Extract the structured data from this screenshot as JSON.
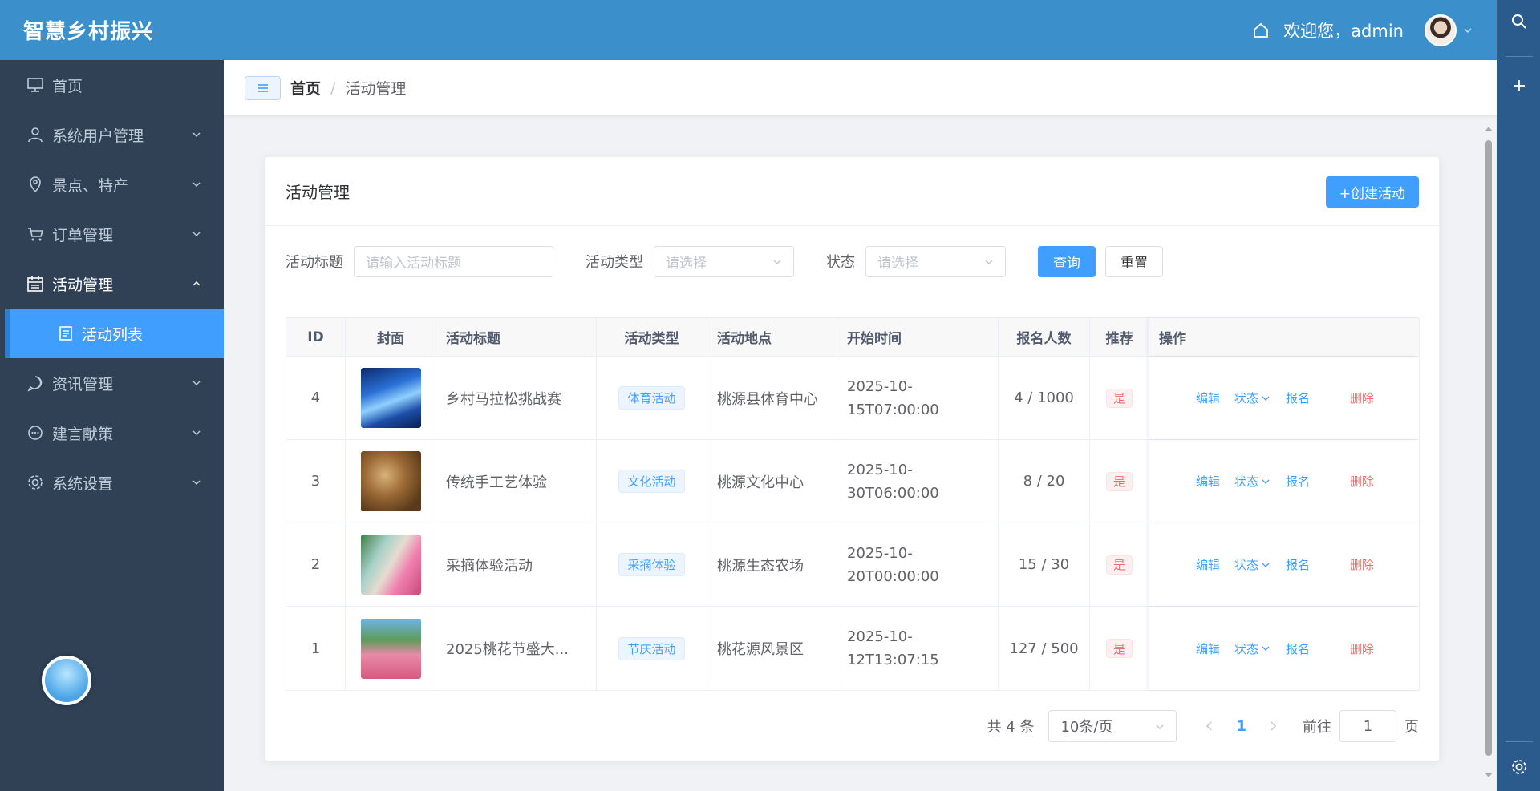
{
  "header": {
    "brand": "智慧乡村振兴",
    "welcome": "欢迎您，admin",
    "home_icon": "home-icon",
    "avatar": "avatar"
  },
  "sidebar": {
    "items": [
      {
        "label": "首页",
        "icon": "monitor-icon"
      },
      {
        "label": "系统用户管理",
        "icon": "user-icon"
      },
      {
        "label": "景点、特产",
        "icon": "location-icon"
      },
      {
        "label": "订单管理",
        "icon": "cart-icon"
      },
      {
        "label": "活动管理",
        "icon": "calendar-icon"
      },
      {
        "label": "资讯管理",
        "icon": "chat-icon"
      },
      {
        "label": "建言献策",
        "icon": "chat-dots-icon"
      },
      {
        "label": "系统设置",
        "icon": "gear-icon"
      }
    ],
    "submenu": {
      "label": "活动列表",
      "icon": "document-icon"
    }
  },
  "breadcrumb": {
    "home": "首页",
    "separator": "/",
    "current": "活动管理"
  },
  "card": {
    "title": "活动管理",
    "create_button": "+创建活动"
  },
  "filter": {
    "title_label": "活动标题",
    "title_placeholder": "请输入活动标题",
    "type_label": "活动类型",
    "type_placeholder": "请选择",
    "status_label": "状态",
    "status_placeholder": "请选择",
    "query_button": "查询",
    "reset_button": "重置"
  },
  "table": {
    "columns": [
      "ID",
      "封面",
      "活动标题",
      "活动类型",
      "活动地点",
      "开始时间",
      "报名人数",
      "推荐",
      "操作"
    ],
    "rows": [
      {
        "id": "4",
        "title": "乡村马拉松挑战赛",
        "type": "体育活动",
        "location": "桃源县体育中心",
        "start": "2025-10-15T07:00:00",
        "count": "4 / 1000",
        "recommend": "是",
        "cover": "cover-blue"
      },
      {
        "id": "3",
        "title": "传统手工艺体验",
        "type": "文化活动",
        "location": "桃源文化中心",
        "start": "2025-10-30T06:00:00",
        "count": "8 / 20",
        "recommend": "是",
        "cover": "cover-brown"
      },
      {
        "id": "2",
        "title": "采摘体验活动",
        "type": "采摘体验",
        "location": "桃源生态农场",
        "start": "2025-10-20T00:00:00",
        "count": "15 / 30",
        "recommend": "是",
        "cover": "cover-orchard"
      },
      {
        "id": "1",
        "title": "2025桃花节盛大...",
        "type": "节庆活动",
        "location": "桃花源风景区",
        "start": "2025-10-12T13:07:15",
        "count": "127 / 500",
        "recommend": "是",
        "cover": "cover-flowers"
      }
    ],
    "ops": {
      "edit": "编辑",
      "status": "状态",
      "enroll": "报名",
      "delete": "删除"
    }
  },
  "pagination": {
    "total": "共 4 条",
    "page_size": "10条/页",
    "current": "1",
    "goto_label": "前往",
    "goto_value": "1",
    "page_unit": "页"
  },
  "colors": {
    "primary": "#409eff",
    "header": "#3b8fcb",
    "sidebar": "#304156",
    "danger": "#f56c6c"
  }
}
